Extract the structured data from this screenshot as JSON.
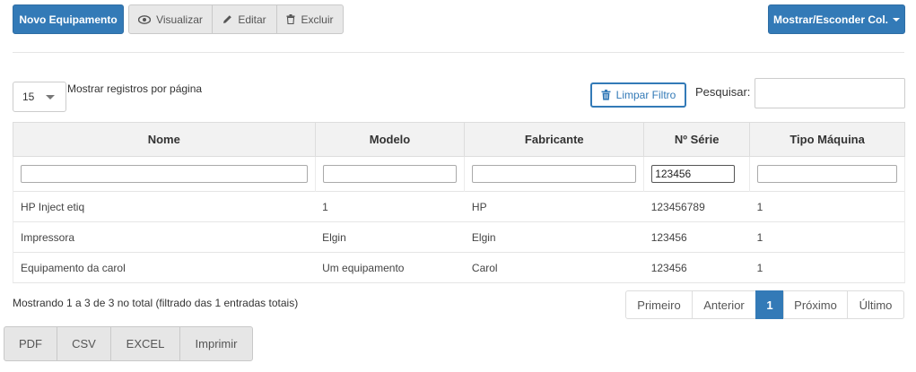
{
  "toolbar": {
    "new_label": "Novo Equipamento",
    "view_label": "Visualizar",
    "edit_label": "Editar",
    "delete_label": "Excluir",
    "toggle_cols_label": "Mostrar/Esconder Col."
  },
  "length": {
    "value": "15",
    "label": "Mostrar registros por página"
  },
  "filter": {
    "clear_label": "Limpar Filtro",
    "search_label": "Pesquisar:",
    "search_value": ""
  },
  "table": {
    "headers": [
      "Nome",
      "Modelo",
      "Fabricante",
      "Nº Série",
      "Tipo Máquina"
    ],
    "column_filters": [
      "",
      "",
      "",
      "123456",
      ""
    ],
    "rows": [
      [
        "HP Inject etiq",
        "1",
        "HP",
        "123456789",
        "1"
      ],
      [
        "Impressora",
        "Elgin",
        "Elgin",
        "123456",
        "1"
      ],
      [
        "Equipamento da carol",
        "Um equipamento",
        "Carol",
        "123456",
        "1"
      ]
    ]
  },
  "info_text": "Mostrando 1 a 3 de 3 no total (filtrado das 1 entradas totais)",
  "pagination": {
    "first": "Primeiro",
    "prev": "Anterior",
    "current": "1",
    "next": "Próximo",
    "last": "Último"
  },
  "export": {
    "pdf": "PDF",
    "csv": "CSV",
    "excel": "EXCEL",
    "print": "Imprimir"
  },
  "colors": {
    "primary": "#337ab7"
  },
  "icons": {
    "view": "eye-icon",
    "edit": "pencil-icon",
    "delete": "trash-icon",
    "dropdown": "caret-down-icon",
    "clear_filter": "trash-icon"
  }
}
